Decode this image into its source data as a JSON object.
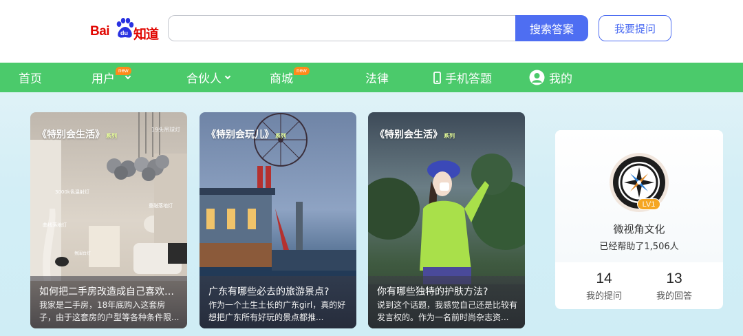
{
  "header": {
    "logo_text_left": "Bai",
    "logo_text_du": "du",
    "logo_text_right": "知道",
    "search": {
      "value": "",
      "placeholder": ""
    },
    "search_button": "搜索答案",
    "ask_button": "我要提问"
  },
  "nav": {
    "items": [
      {
        "label": "首页"
      },
      {
        "label": "用户",
        "badge": "new"
      },
      {
        "label": "合伙人"
      },
      {
        "label": "商城",
        "badge": "new"
      },
      {
        "label": "法律"
      },
      {
        "label": "手机答题"
      },
      {
        "label": "我的"
      }
    ]
  },
  "colors": {
    "nav_green": "#4bca6b",
    "brand_blue": "#4e6ef2",
    "baidu_red": "#e10601",
    "badge_orange": "#ff8a1a"
  },
  "cards": [
    {
      "series_label": "《特别会生活》",
      "series_suffix": "系列",
      "image_captions": [
        "19头吊球灯",
        "3000k色温射灯",
        "重磁落地灯",
        "曲线落地灯",
        "氛围台灯"
      ],
      "title": "如何把二手房改造成自己喜欢的...",
      "desc": "我家是二手房，18年底购入这套房子，由于这套房的户型等各种条件限..."
    },
    {
      "series_label": "《特别会玩儿》",
      "series_suffix": "系列",
      "title": "广东有哪些必去的旅游景点?",
      "desc": "作为一个土生土长的广东girl，真的好想把广东所有好玩的景点都推..."
    },
    {
      "series_label": "《特别会生活》",
      "series_suffix": "系列",
      "title": "你有哪些独特的护肤方法?",
      "desc": "说到这个话题，我感觉自己还是比较有发言权的。作为一名前时尚杂志资..."
    }
  ],
  "profile": {
    "name": "微视角文化",
    "level": "LV1",
    "helped": "已经帮助了1,506人",
    "questions": {
      "count": "14",
      "label": "我的提问"
    },
    "answers": {
      "count": "13",
      "label": "我的回答"
    }
  }
}
